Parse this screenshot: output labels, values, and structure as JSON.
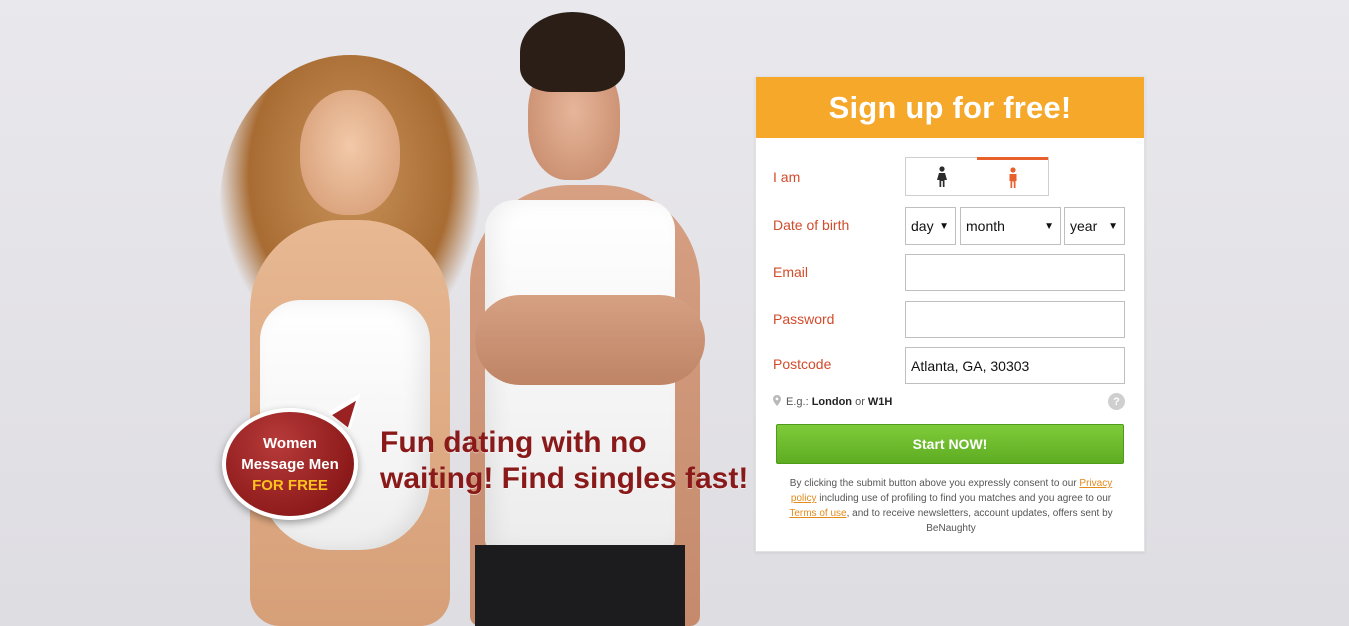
{
  "hero": {
    "badge": {
      "line1": "Women",
      "line2": "Message Men",
      "line3": "FOR FREE"
    },
    "tagline": "Fun dating with no waiting! Find singles fast!"
  },
  "signup": {
    "title": "Sign up for free!",
    "iam_label": "I am",
    "gender": {
      "options": [
        "female",
        "male"
      ],
      "selected": "male",
      "female_icon": "female-figure-icon",
      "male_icon": "male-figure-icon"
    },
    "dob_label": "Date of birth",
    "dob": {
      "day": "day",
      "month": "month",
      "year": "year"
    },
    "email_label": "Email",
    "email_value": "",
    "password_label": "Password",
    "password_value": "",
    "postcode_label": "Postcode",
    "postcode_value": "Atlanta, GA, 30303",
    "hint": {
      "prefix": "E.g.:",
      "example1": "London",
      "or": "or",
      "example2": "W1H"
    },
    "help": "?",
    "submit_label": "Start NOW!",
    "legal": {
      "part1": "By clicking the submit button above you expressly consent to our",
      "privacy_link": "Privacy policy",
      "part2": "including use of profiling to find you matches and you agree to our",
      "terms_link": "Terms of use",
      "part3": ", and to receive newsletters, account updates, offers sent by BeNaughty"
    },
    "colors": {
      "header": "#f5a82a",
      "label": "#d24b2b",
      "submit": "#6ab82c",
      "link": "#e48a1b"
    }
  }
}
